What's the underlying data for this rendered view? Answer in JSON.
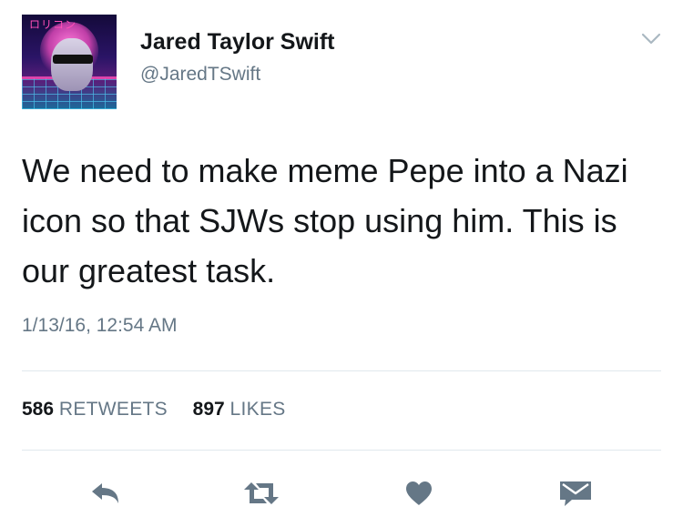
{
  "tweet": {
    "author": {
      "name": "Jared Taylor Swift",
      "handle": "@JaredTSwift",
      "avatar_text": "ロリコン",
      "avatar_icon": "retro-vaporwave-avatar"
    },
    "menu_icon": "chevron-down-icon",
    "text": "We need to make meme Pepe into a Nazi icon so that SJWs stop using him. This is our greatest task.",
    "timestamp": "1/13/16, 12:54 AM",
    "stats": {
      "retweets_count": "586",
      "retweets_label": "RETWEETS",
      "likes_count": "897",
      "likes_label": "LIKES"
    },
    "actions": [
      {
        "icon": "reply-icon"
      },
      {
        "icon": "retweet-icon"
      },
      {
        "icon": "heart-icon"
      },
      {
        "icon": "direct-message-icon"
      }
    ],
    "colors": {
      "text": "#14171a",
      "secondary": "#657786",
      "icon": "#657786",
      "divider": "#e1e8ed"
    }
  }
}
